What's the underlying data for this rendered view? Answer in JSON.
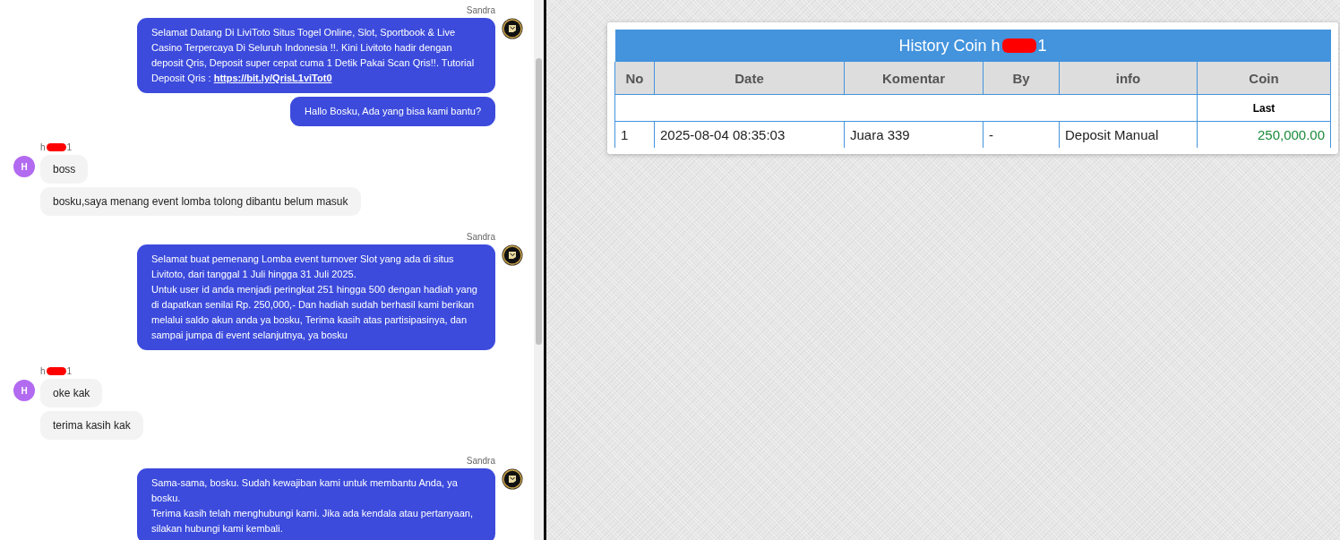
{
  "chat": {
    "groups": [
      {
        "kind": "agent",
        "sender": "Sandra",
        "messages": [
          {
            "text": "Selamat Datang Di LiviToto Situs Togel Online, Slot, Sportbook & Live Casino Terpercaya Di Seluruh Indonesia !!. Kini Livitoto hadir dengan deposit Qris, Deposit super cepat cuma 1 Detik Pakai Scan Qris!!. Tutorial Deposit Qris : ",
            "link": "https://bit.ly/QrisL1viTot0"
          },
          {
            "text": "Hallo Bosku, Ada yang bisa kami bantu?"
          }
        ]
      },
      {
        "kind": "user",
        "sender_start": "h",
        "sender_end": "1",
        "redacted": true,
        "avatar": "H",
        "messages": [
          {
            "text": "boss"
          },
          {
            "text": "bosku,saya menang event lomba tolong dibantu belum masuk"
          }
        ]
      },
      {
        "kind": "agent",
        "sender": "Sandra",
        "messages": [
          {
            "text": "Selamat buat pemenang Lomba event turnover Slot yang ada di situs Livitoto, dari tanggal 1 Juli hingga 31 Juli 2025.\nUntuk user id anda menjadi peringkat 251 hingga 500 dengan hadiah yang di dapatkan senilai Rp. 250,000,- Dan hadiah sudah berhasil kami berikan melalui saldo akun anda ya bosku, Terima kasih atas partisipasinya, dan sampai jumpa di event selanjutnya, ya bosku"
          }
        ]
      },
      {
        "kind": "user",
        "sender_start": "h",
        "sender_end": "1",
        "redacted": true,
        "avatar": "H",
        "messages": [
          {
            "text": "oke kak"
          },
          {
            "text": "terima kasih kak"
          }
        ]
      },
      {
        "kind": "agent",
        "sender": "Sandra",
        "messages": [
          {
            "text": "Sama-sama, bosku. Sudah kewajiban kami untuk membantu Anda, ya bosku.\nTerima kasih telah menghubungi kami. Jika ada kendala atau pertanyaan, silakan hubungi kami kembali."
          }
        ]
      }
    ]
  },
  "history": {
    "title_start": "History Coin h",
    "title_end": "1",
    "redacted": true,
    "columns": [
      "No",
      "Date",
      "Komentar",
      "By",
      "info",
      "Coin"
    ],
    "subheader": "Last",
    "rows": [
      {
        "cells": [
          "1",
          "2025-08-04 08:35:03",
          "Juara 339",
          "-",
          "Deposit Manual",
          "250,000.00"
        ]
      }
    ]
  }
}
